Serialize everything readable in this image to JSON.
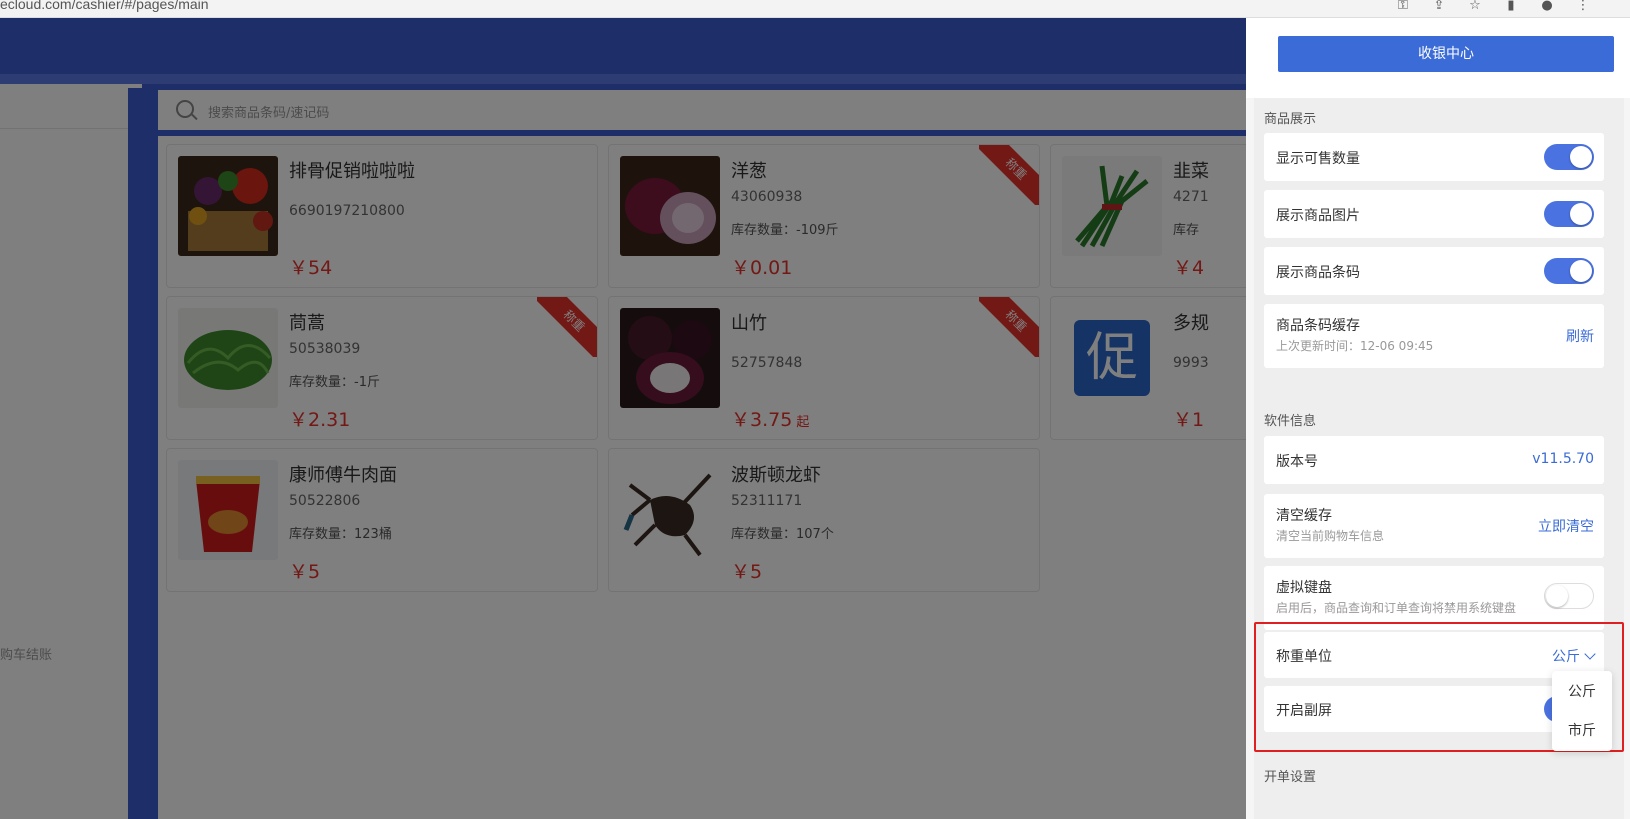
{
  "browser": {
    "url": "ecloud.com/cashier/#/pages/main"
  },
  "search": {
    "placeholder": "搜索商品条码/速记码"
  },
  "left_panel": {
    "hint": "购车结账"
  },
  "products": [
    {
      "name": "排骨促销啦啦啦",
      "code": "6690197210800",
      "stock": "",
      "price": "￥54",
      "suffix": "",
      "ribbon": "",
      "image": "vegetables-basket"
    },
    {
      "name": "洋葱",
      "code": "43060938",
      "stock": "库存数量：-109斤",
      "price": "￥0.01",
      "suffix": "",
      "ribbon": "称重",
      "image": "onion"
    },
    {
      "name": "韭菜",
      "code": "4271",
      "stock": "库存",
      "price": "￥4",
      "suffix": "",
      "ribbon": "",
      "image": "chives"
    },
    {
      "name": "茼蒿",
      "code": "50538039",
      "stock": "库存数量：-1斤",
      "price": "￥2.31",
      "suffix": "",
      "ribbon": "称重",
      "image": "greens"
    },
    {
      "name": "山竹",
      "code": "52757848",
      "stock": "",
      "price": "￥3.75",
      "suffix": "起",
      "ribbon": "称重",
      "image": "mangosteen"
    },
    {
      "name": "多规",
      "code": "9993",
      "stock": "",
      "price": "￥1",
      "suffix": "",
      "ribbon": "",
      "image": "promo-icon",
      "promo_char": "促"
    },
    {
      "name": "康师傅牛肉面",
      "code": "50522806",
      "stock": "库存数量：123桶",
      "price": "￥5",
      "suffix": "",
      "ribbon": "",
      "image": "noodle-cup"
    },
    {
      "name": "波斯顿龙虾",
      "code": "52311171",
      "stock": "库存数量：107个",
      "price": "￥5",
      "suffix": "",
      "ribbon": "",
      "image": "lobster"
    }
  ],
  "drawer": {
    "primary_button": "收银中心",
    "display_section": {
      "title": "商品展示",
      "rows": [
        {
          "label": "显示可售数量",
          "toggle": true
        },
        {
          "label": "展示商品图片",
          "toggle": true
        },
        {
          "label": "展示商品条码",
          "toggle": true
        }
      ],
      "cache": {
        "label": "商品条码缓存",
        "sub": "上次更新时间：12-06 09:45",
        "action": "刷新"
      }
    },
    "software_section": {
      "title": "软件信息",
      "version_label": "版本号",
      "version_value": "v11.5.70",
      "clear_label": "清空缓存",
      "clear_sub": "清空当前购物车信息",
      "clear_action": "立即清空",
      "keyboard_label": "虚拟键盘",
      "keyboard_sub": "启用后，商品查询和订单查询将禁用系统键盘",
      "keyboard_toggle": false,
      "weight_label": "称重单位",
      "weight_value": "公斤",
      "second_screen_label": "开启副屏",
      "weight_options": [
        "公斤",
        "市斤"
      ]
    },
    "order_section": {
      "title": "开单设置"
    }
  },
  "colors": {
    "accent": "#3a6bd6",
    "price": "#e5322d",
    "highlight": "#e02020"
  }
}
